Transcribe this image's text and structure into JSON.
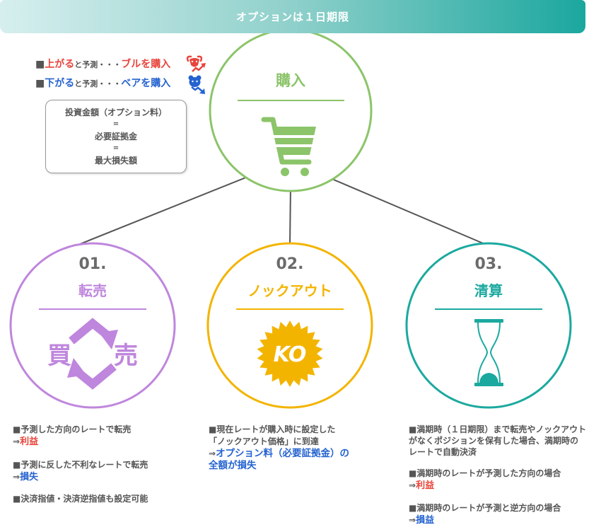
{
  "banner": {
    "title": "オプションは１日期限",
    "gradient_from": "#d6efee",
    "gradient_to": "#1ba79e"
  },
  "legend": {
    "bull": {
      "bullet": "■",
      "trigger": "上がる",
      "middle": "と予測・・・",
      "action": "ブルを購入",
      "icon": "bull-icon",
      "color": "#e8453c"
    },
    "bear": {
      "bullet": "■",
      "trigger": "下がる",
      "middle": "と予測・・・",
      "action": "ベアを購入",
      "icon": "bear-icon",
      "color": "#2563d0"
    }
  },
  "cost_box": {
    "lines": [
      "投資金額（オプション料）",
      "=",
      "必要証拠金",
      "=",
      "最大損失額"
    ]
  },
  "purchase": {
    "title": "購入",
    "icon": "shopping-cart-icon",
    "color": "#8cc46a"
  },
  "steps": [
    {
      "number": "01.",
      "title": "転売",
      "color": "#bf86dd",
      "icon": "buy-sell-cycle-icon",
      "buy_label": "買",
      "sell_label": "売"
    },
    {
      "number": "02.",
      "title": "ノックアウト",
      "color": "#f3b400",
      "icon": "knockout-badge-icon",
      "badge_label": "KO"
    },
    {
      "number": "03.",
      "title": "清算",
      "color": "#1ba99f",
      "icon": "hourglass-icon"
    }
  ],
  "notes": {
    "resale": [
      {
        "condition": "■予測した方向のレートで転売",
        "arrow": "⇒",
        "result": "利益",
        "result_color": "#e8453c"
      },
      {
        "condition": "■予測に反した不利なレートで転売",
        "arrow": "⇒",
        "result": "損失",
        "result_color": "#2563d0"
      },
      {
        "condition": "■決済指値・決済逆指値も設定可能"
      }
    ],
    "knockout": [
      {
        "condition_lines": [
          "■現在レートが購入時に設定した",
          "「ノックアウト価格」に到達"
        ],
        "arrow": "⇒",
        "result_lines": [
          "オプション料（必要証拠金）の",
          "全額が損失"
        ],
        "result_color": "#2563d0"
      }
    ],
    "settlement": [
      {
        "condition_lines": [
          "■満期時（１日期限）まで転売やノックアウト",
          "がなくポジションを保有した場合、満期時の",
          "レートで自動決済"
        ]
      },
      {
        "condition": "■満期時のレートが予測した方向の場合",
        "arrow": "⇒",
        "result": "利益",
        "result_color": "#e8453c"
      },
      {
        "condition": "■満期時のレートが予測と逆方向の場合",
        "arrow": "⇒",
        "result": "損益",
        "result_color": "#2563d0"
      }
    ]
  },
  "colors": {
    "text": "#555555",
    "connector": "#555555",
    "step_number": "#6b6b6b"
  }
}
